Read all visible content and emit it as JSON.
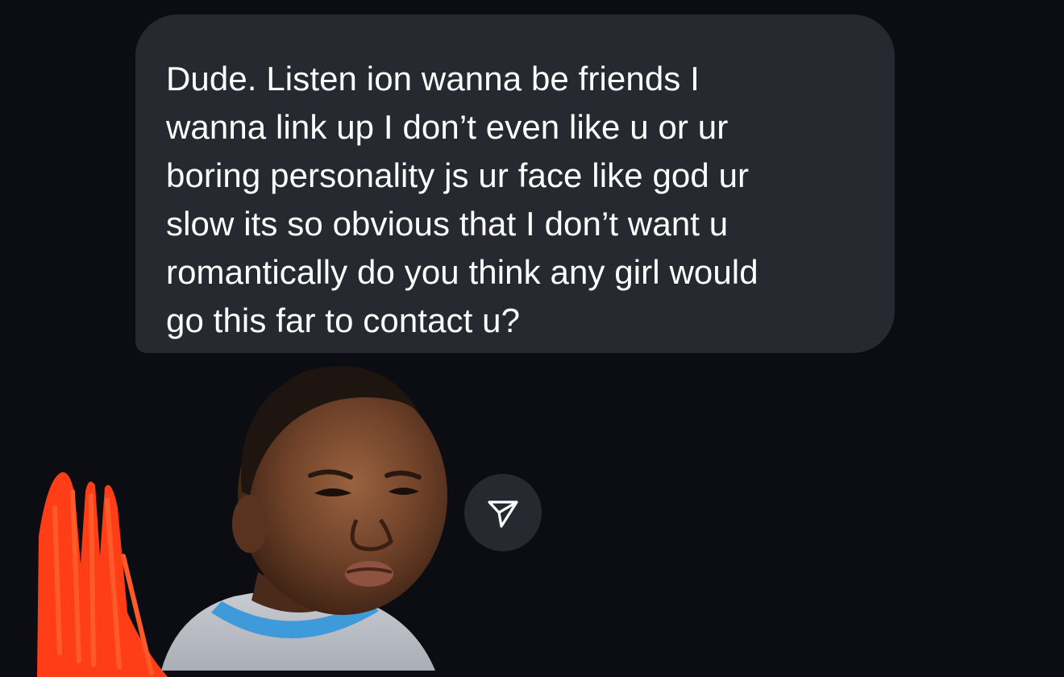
{
  "conversation": {
    "message": {
      "text": "Dude. Listen ion wanna be friends I\nwanna link up I don’t even like u or ur\nboring personality js ur face like god ur\nslow its so obvious that I don’t want u\nromantically do you think any girl would\ngo this far to contact u?"
    },
    "sticker": {
      "icon": "baby-side-eye-sticker"
    },
    "share_button": {
      "icon": "paper-plane-icon"
    },
    "redaction": {
      "color": "#ff3d17"
    }
  },
  "colors": {
    "background": "#0b0d12",
    "bubble": "#262a30",
    "text": "#ffffff"
  }
}
